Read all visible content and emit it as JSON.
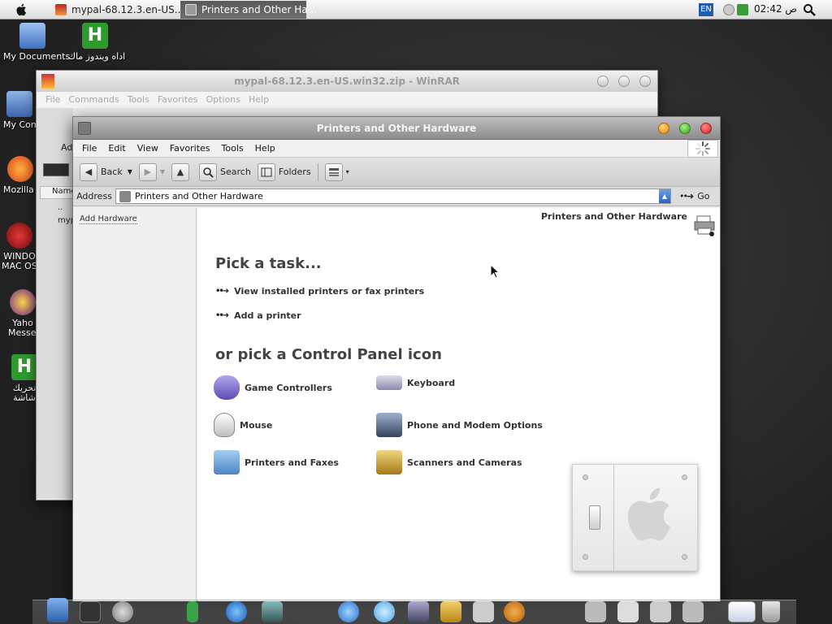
{
  "menubar": {
    "tasks": [
      {
        "label": "mypal-68.12.3.en-US....",
        "active": false
      },
      {
        "label": "Printers and Other Ha...",
        "active": true
      }
    ],
    "lang": "EN",
    "clock": "02:42 ص"
  },
  "desktop": {
    "icons": [
      {
        "label": "My Documents",
        "color": "#5b8fd6"
      },
      {
        "label": "اداه ويندوز ماك",
        "color": "#2f9b2f"
      },
      {
        "label": "My Com",
        "color": "#4a76b8"
      },
      {
        "label": "Mozilla F",
        "color": "#e36a16"
      },
      {
        "label": "WINDO",
        "label2": "MAC OS",
        "color": "#b51f1f"
      },
      {
        "label": "Yaho",
        "label2": "Messen",
        "color": "#6b2a8a"
      },
      {
        "label": "تحريك",
        "label2": "شاشة",
        "color": "#2f9b2f"
      }
    ]
  },
  "winrar": {
    "title": "mypal-68.12.3.en-US.win32.zip - WinRAR",
    "menu": [
      "File",
      "Commands",
      "Tools",
      "Favorites",
      "Options",
      "Help"
    ],
    "side_labels": [
      "Ad",
      "Name",
      "..",
      "myp"
    ]
  },
  "window": {
    "title": "Printers and Other Hardware",
    "menu": [
      "File",
      "Edit",
      "View",
      "Favorites",
      "Tools",
      "Help"
    ],
    "toolbar": {
      "back": "Back",
      "search": "Search",
      "folders": "Folders"
    },
    "address": {
      "label": "Address",
      "value": "Printers and Other Hardware",
      "go": "Go"
    },
    "left_pane": {
      "items": [
        "Add Hardware"
      ]
    },
    "content": {
      "header": "Printers and Other Hardware",
      "pick_task": "Pick a task...",
      "tasks": [
        "View installed printers or fax printers",
        "Add a printer"
      ],
      "or_pick": "or pick a Control Panel icon",
      "icons": [
        {
          "label": "Game Controllers",
          "color": "#7a6ccc"
        },
        {
          "label": "Keyboard",
          "color": "#8a8aa8"
        },
        {
          "label": "Mouse",
          "color": "#cfcfcf"
        },
        {
          "label": "Phone and Modem Options",
          "color": "#556b8f"
        },
        {
          "label": "Printers and Faxes",
          "color": "#5e9bd6"
        },
        {
          "label": "Scanners and Cameras",
          "color": "#c8a030"
        }
      ]
    }
  },
  "colors": {
    "close": "#d21c1c",
    "minimize": "#e98a00",
    "maximize": "#3aa31d"
  }
}
